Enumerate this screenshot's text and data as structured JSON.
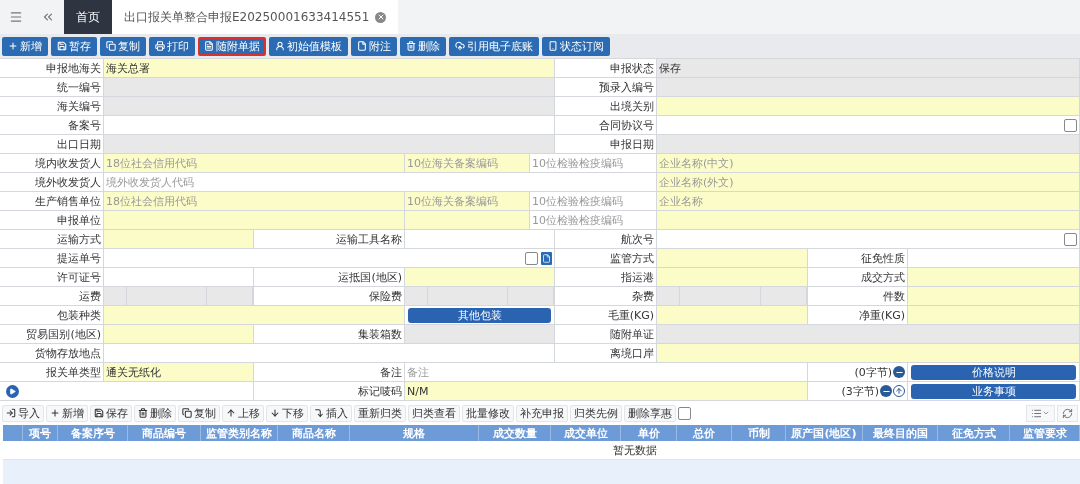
{
  "tabs": [
    {
      "label": "首页",
      "selected": true,
      "closable": false
    },
    {
      "label": "出口报关单整合申报E20250001633414551",
      "selected": false,
      "closable": true
    }
  ],
  "toolbar": [
    {
      "label": "新增",
      "kind": "add",
      "highlighted": false
    },
    {
      "label": "暂存",
      "kind": "save",
      "highlighted": false
    },
    {
      "label": "复制",
      "kind": "copy",
      "highlighted": false
    },
    {
      "label": "打印",
      "kind": "print",
      "highlighted": false
    },
    {
      "label": "随附单据",
      "kind": "doc",
      "highlighted": true
    },
    {
      "label": "初始值模板",
      "kind": "template",
      "highlighted": false
    },
    {
      "label": "附注",
      "kind": "file",
      "highlighted": false
    },
    {
      "label": "删除",
      "kind": "delete",
      "highlighted": false
    },
    {
      "label": "引用电子底账",
      "kind": "cloud",
      "highlighted": false
    },
    {
      "label": "状态订阅",
      "kind": "phone",
      "highlighted": false
    }
  ],
  "form_rows": [
    {
      "kind": "halves",
      "cells": [
        {
          "kind": "label",
          "text": "申报地海关"
        },
        {
          "kind": "field",
          "required": true,
          "readonly": false,
          "value": "海关总署"
        },
        {
          "kind": "label",
          "text": "申报状态"
        },
        {
          "kind": "field",
          "readonly": true,
          "value": "保存"
        }
      ]
    },
    {
      "kind": "halves",
      "cells": [
        {
          "kind": "label",
          "text": "统一编号"
        },
        {
          "kind": "field",
          "readonly": true
        },
        {
          "kind": "label",
          "text": "预录入编号"
        },
        {
          "kind": "field",
          "readonly": true
        }
      ]
    },
    {
      "kind": "halves",
      "cells": [
        {
          "kind": "label",
          "text": "海关编号"
        },
        {
          "kind": "field",
          "readonly": true
        },
        {
          "kind": "label",
          "text": "出境关别"
        },
        {
          "kind": "field",
          "required": true,
          "readonly": false
        }
      ]
    },
    {
      "kind": "halves",
      "cells": [
        {
          "kind": "label",
          "text": "备案号"
        },
        {
          "kind": "field",
          "required": false,
          "readonly": false
        },
        {
          "kind": "label",
          "text": "合同协议号"
        },
        {
          "kind": "field",
          "required": false,
          "readonly": false,
          "checkbox": {
            "checked": false
          }
        }
      ]
    },
    {
      "kind": "halves",
      "cells": [
        {
          "kind": "label",
          "text": "出口日期"
        },
        {
          "kind": "field",
          "readonly": true
        },
        {
          "kind": "label",
          "text": "申报日期"
        },
        {
          "kind": "field",
          "readonly": true
        }
      ]
    },
    {
      "kind": "party",
      "cells": [
        {
          "kind": "label",
          "text": "境内收发货人"
        },
        {
          "kind": "field",
          "required": true,
          "readonly": false,
          "placeholder": "18位社会信用代码"
        },
        {
          "kind": "field",
          "required": true,
          "readonly": false,
          "placeholder": "10位海关备案编码"
        },
        {
          "kind": "field",
          "required": false,
          "readonly": false,
          "placeholder": "10位检验检疫编码"
        },
        {
          "kind": "field",
          "required": true,
          "readonly": false,
          "placeholder": "企业名称(中文)"
        }
      ]
    },
    {
      "kind": "foreign_party",
      "cells": [
        {
          "kind": "label",
          "text": "境外收发货人"
        },
        {
          "kind": "field",
          "required": false,
          "readonly": false,
          "placeholder": "境外收发货人代码"
        },
        {
          "kind": "field",
          "required": true,
          "readonly": false,
          "placeholder": "企业名称(外文)"
        }
      ]
    },
    {
      "kind": "party",
      "cells": [
        {
          "kind": "label",
          "text": "生产销售单位"
        },
        {
          "kind": "field",
          "required": true,
          "readonly": false,
          "placeholder": "18位社会信用代码"
        },
        {
          "kind": "field",
          "required": true,
          "readonly": false,
          "placeholder": "10位海关备案编码"
        },
        {
          "kind": "field",
          "required": false,
          "readonly": false,
          "placeholder": "10位检验检疫编码"
        },
        {
          "kind": "field",
          "required": true,
          "readonly": false,
          "placeholder": "企业名称"
        }
      ]
    },
    {
      "kind": "party",
      "cells": [
        {
          "kind": "label",
          "text": "申报单位"
        },
        {
          "kind": "field",
          "required": true,
          "readonly": false
        },
        {
          "kind": "field",
          "required": true,
          "readonly": false
        },
        {
          "kind": "field",
          "required": false,
          "readonly": false,
          "placeholder": "10位检验检疫编码"
        },
        {
          "kind": "field",
          "required": true,
          "readonly": false
        }
      ]
    },
    {
      "kind": "transport",
      "cells": [
        {
          "kind": "label",
          "text": "运输方式"
        },
        {
          "kind": "field",
          "required": true,
          "readonly": false
        },
        {
          "kind": "label",
          "text": "运输工具名称"
        },
        {
          "kind": "field",
          "required": false,
          "readonly": false
        },
        {
          "kind": "label",
          "text": "航次号"
        },
        {
          "kind": "field",
          "required": false,
          "readonly": false,
          "checkbox": {
            "checked": false
          }
        }
      ]
    },
    {
      "kind": "bill",
      "cells": [
        {
          "kind": "label",
          "text": "提运单号"
        },
        {
          "kind": "field",
          "required": false,
          "readonly": false,
          "checkbox": {
            "checked": false
          },
          "doc_button": true
        },
        {
          "kind": "label",
          "text": "监管方式"
        },
        {
          "kind": "field",
          "required": true,
          "readonly": false
        },
        {
          "kind": "label",
          "text": "征免性质"
        },
        {
          "kind": "field",
          "required": false,
          "readonly": false
        }
      ]
    },
    {
      "kind": "quad",
      "cells": [
        {
          "kind": "label",
          "text": "许可证号"
        },
        {
          "kind": "field",
          "required": false,
          "readonly": false
        },
        {
          "kind": "label",
          "text": "运抵国(地区)"
        },
        {
          "kind": "field",
          "required": true,
          "readonly": false
        },
        {
          "kind": "label",
          "text": "指运港"
        },
        {
          "kind": "field",
          "required": true,
          "readonly": false
        },
        {
          "kind": "label",
          "text": "成交方式"
        },
        {
          "kind": "field",
          "required": true,
          "readonly": false
        }
      ]
    },
    {
      "kind": "quad",
      "cells": [
        {
          "kind": "label",
          "text": "运费"
        },
        {
          "kind": "fee"
        },
        {
          "kind": "label",
          "text": "保险费"
        },
        {
          "kind": "fee"
        },
        {
          "kind": "label",
          "text": "杂费"
        },
        {
          "kind": "fee"
        },
        {
          "kind": "label",
          "text": "件数"
        },
        {
          "kind": "field",
          "required": true,
          "readonly": false
        }
      ]
    },
    {
      "kind": "packing",
      "cells": [
        {
          "kind": "label",
          "text": "包装种类"
        },
        {
          "kind": "field",
          "required": true,
          "readonly": false
        },
        {
          "kind": "button",
          "label": "其他包装"
        },
        {
          "kind": "label",
          "text": "毛重(KG)"
        },
        {
          "kind": "field",
          "required": true,
          "readonly": false
        },
        {
          "kind": "label",
          "text": "净重(KG)"
        },
        {
          "kind": "field",
          "required": true,
          "readonly": false
        }
      ]
    },
    {
      "kind": "transport",
      "cells": [
        {
          "kind": "label",
          "text": "贸易国别(地区)"
        },
        {
          "kind": "field",
          "required": true,
          "readonly": false
        },
        {
          "kind": "label",
          "text": "集装箱数"
        },
        {
          "kind": "field",
          "readonly": true
        },
        {
          "kind": "label",
          "text": "随附单证"
        },
        {
          "kind": "field",
          "readonly": true
        }
      ]
    },
    {
      "kind": "halves",
      "cells": [
        {
          "kind": "label",
          "text": "货物存放地点"
        },
        {
          "kind": "field",
          "required": false,
          "readonly": false
        },
        {
          "kind": "label",
          "text": "离境口岸"
        },
        {
          "kind": "field",
          "required": true,
          "readonly": false
        }
      ]
    },
    {
      "kind": "note",
      "cells": [
        {
          "kind": "label",
          "text": "报关单类型"
        },
        {
          "kind": "field",
          "required": true,
          "readonly": false,
          "value": "通关无纸化"
        },
        {
          "kind": "label",
          "text": "备注"
        },
        {
          "kind": "field",
          "required": false,
          "readonly": false,
          "placeholder": "备注"
        },
        {
          "kind": "counter",
          "text": "(0字节)",
          "actions": [
            {
              "kind": "remove"
            }
          ]
        },
        {
          "kind": "button",
          "label": "价格说明"
        }
      ]
    },
    {
      "kind": "marks",
      "cells": [
        {
          "kind": "toggle"
        },
        {
          "kind": "label",
          "text": "标记唛码"
        },
        {
          "kind": "field",
          "required": true,
          "readonly": false,
          "value": "N/M"
        },
        {
          "kind": "counter",
          "text": "(3字节)",
          "actions": [
            {
              "kind": "remove"
            },
            {
              "kind": "up"
            }
          ]
        },
        {
          "kind": "button",
          "label": "业务事项"
        }
      ]
    }
  ],
  "goods_toolbar": [
    {
      "label": "导入",
      "kind": "import"
    },
    {
      "label": "新增",
      "kind": "add"
    },
    {
      "label": "保存",
      "kind": "save"
    },
    {
      "label": "删除",
      "kind": "delete"
    },
    {
      "label": "复制",
      "kind": "copy"
    },
    {
      "label": "上移",
      "kind": "up"
    },
    {
      "label": "下移",
      "kind": "down"
    },
    {
      "label": "插入",
      "kind": "insert"
    },
    {
      "label": "重新归类",
      "kind": "text"
    },
    {
      "label": "归类查看",
      "kind": "text"
    },
    {
      "label": "批量修改",
      "kind": "text"
    },
    {
      "label": "补充申报",
      "kind": "text"
    },
    {
      "label": "归类先例",
      "kind": "text"
    },
    {
      "label": "删除享惠",
      "kind": "text"
    }
  ],
  "goods_select_all": {
    "checked": false
  },
  "goods_table": {
    "columns": [
      "项号",
      "备案序号",
      "商品编号",
      "监管类别名称",
      "商品名称",
      "规格",
      "成交数量",
      "成交单位",
      "单价",
      "总价",
      "币制",
      "原产国(地区)",
      "最终目的国",
      "征免方式",
      "监管要求"
    ],
    "empty_text": "暂无数据"
  }
}
